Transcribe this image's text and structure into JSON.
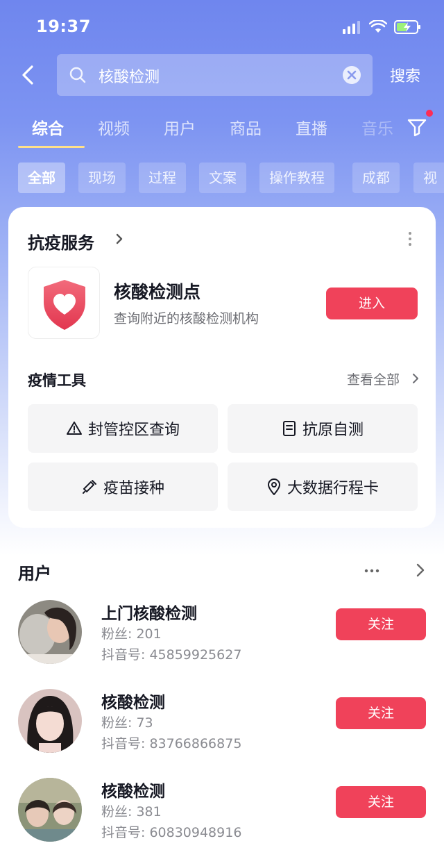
{
  "status_bar": {
    "time": "19:37"
  },
  "search": {
    "query": "核酸检测",
    "search_button": "搜索"
  },
  "tabs": [
    {
      "label": "综合",
      "active": true
    },
    {
      "label": "视频"
    },
    {
      "label": "用户"
    },
    {
      "label": "商品"
    },
    {
      "label": "直播"
    },
    {
      "label": "音乐"
    }
  ],
  "chips": [
    {
      "label": "全部",
      "active": true
    },
    {
      "label": "现场"
    },
    {
      "label": "过程"
    },
    {
      "label": "文案"
    },
    {
      "label": "操作教程"
    },
    {
      "label": "成都"
    },
    {
      "label": "视频"
    }
  ],
  "service_card": {
    "title": "抗疫服务",
    "service_name": "核酸检测点",
    "service_desc": "查询附近的核酸检测机构",
    "enter_label": "进入",
    "tools_title": "疫情工具",
    "tools_view_all": "查看全部",
    "tools": [
      {
        "label": "封管控区查询",
        "icon": "warning-icon"
      },
      {
        "label": "抗原自测",
        "icon": "document-icon"
      },
      {
        "label": "疫苗接种",
        "icon": "syringe-icon"
      },
      {
        "label": "大数据行程卡",
        "icon": "location-pin-icon"
      }
    ]
  },
  "users_section": {
    "title": "用户",
    "users": [
      {
        "name": "上门核酸检测",
        "fans": "粉丝: 201",
        "douyin_id": "抖音号: 45859925627",
        "follow_label": "关注"
      },
      {
        "name": "核酸检测",
        "fans": "粉丝: 73",
        "douyin_id": "抖音号: 83766866875",
        "follow_label": "关注"
      },
      {
        "name": "核酸检测",
        "fans": "粉丝: 381",
        "douyin_id": "抖音号: 60830948916",
        "follow_label": "关注"
      }
    ]
  },
  "colors": {
    "brand_red": "#f0425a",
    "header_blue": "#7d94f2",
    "tab_underline": "#ffe08a"
  }
}
